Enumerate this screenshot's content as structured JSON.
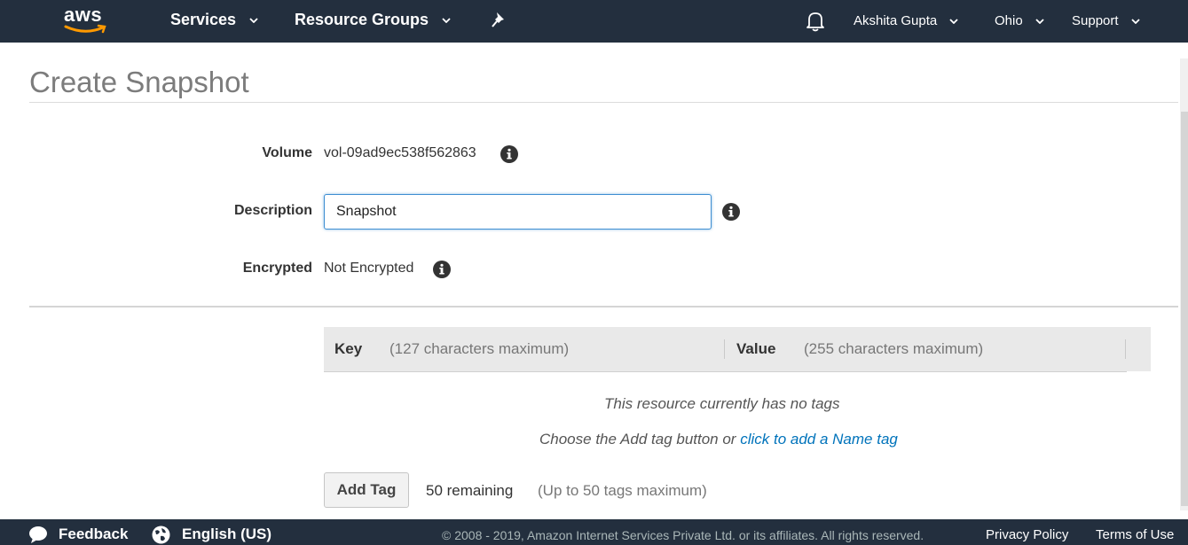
{
  "nav": {
    "logo": "aws",
    "services": "Services",
    "resource_groups": "Resource Groups",
    "user": "Akshita Gupta",
    "region": "Ohio",
    "support": "Support"
  },
  "page": {
    "title": "Create Snapshot"
  },
  "form": {
    "volume_label": "Volume",
    "volume_value": "vol-09ad9ec538f562863",
    "description_label": "Description",
    "description_value": "Snapshot",
    "encrypted_label": "Encrypted",
    "encrypted_value": "Not Encrypted"
  },
  "tags": {
    "key_header": "Key",
    "key_hint": "(127 characters maximum)",
    "value_header": "Value",
    "value_hint": "(255 characters maximum)",
    "empty_message": "This resource currently has no tags",
    "choose_text": "Choose the Add tag button or ",
    "name_tag_link": "click to add a Name tag",
    "add_tag_button": "Add Tag",
    "remaining": "50 remaining",
    "max_hint": "(Up to 50 tags maximum)"
  },
  "footer": {
    "feedback": "Feedback",
    "language": "English (US)",
    "copyright": "© 2008 - 2019, Amazon Internet Services Private Ltd. or its affiliates. All rights reserved.",
    "privacy": "Privacy Policy",
    "terms": "Terms of Use"
  },
  "colors": {
    "topbar_bg": "#232f3e",
    "link": "#0073bb",
    "input_focus": "#3f8fd2",
    "smile": "#ff9900"
  },
  "icons": [
    "bell-icon",
    "pin-icon",
    "info-icon",
    "chevron-down-icon",
    "speech-bubble-icon",
    "globe-icon"
  ]
}
